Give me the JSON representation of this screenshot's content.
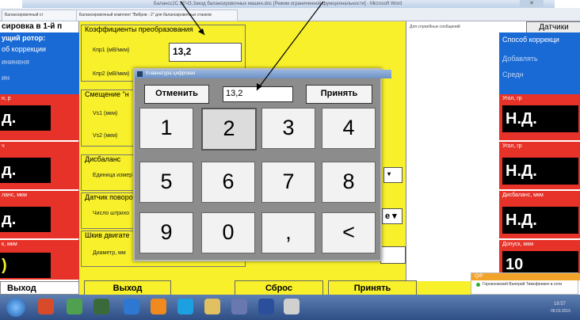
{
  "window": {
    "title": "Балансс2С 3ЕЧЗ.Заезд балансировочных машин.doc [Режим ограниченной функциональности] - Microsoft Word",
    "close_label": "✕"
  },
  "tabs": [
    "Балансировочный ст",
    "Балансировочный комплект \"Вибров - 2\" для балансировочных станков"
  ],
  "left_panel": {
    "header": "сировка в 1-й п",
    "rotor_label": "ущий ротор:",
    "correction_label": "об коррекции",
    "blue_lines": [
      "ининеня",
      "ин"
    ],
    "panels": [
      {
        "label": "н, р",
        "value": "д."
      },
      {
        "label": "ч",
        "value": "д."
      },
      {
        "label": "ланс, мкм",
        "value": "д."
      },
      {
        "label": "к, мкм",
        "value": ")"
      }
    ],
    "exit_label": "Выход"
  },
  "right_panel": {
    "sensors_button": "Датчики",
    "correction_title": "Способ коррекци",
    "blue_lines": [
      "Добавлять",
      "Средн"
    ],
    "panels": [
      {
        "label": "Угол, гр",
        "value": "Н.Д."
      },
      {
        "label": "Угол, гр",
        "value": "Н.Д."
      },
      {
        "label": "Дисбаланс, мкм",
        "value": "Н.Д."
      },
      {
        "label": "Допуск, мкм",
        "value": "10"
      }
    ]
  },
  "main": {
    "coeff_title": "Коэффициенты преобразования",
    "kpp1_label": "Кпр1 (мВ/мкм)",
    "kpp1_value": "13,2",
    "kpp2_label": "Кпр2 (мВ/мкм)",
    "offset_title": "Смещение \"н",
    "vs1_label": "Vs1 (мкм)",
    "vs2_label": "Vs2 (мкм)",
    "imbalance_title": "Дисбаланс",
    "unit_label": "Единица измер",
    "sensor_title": "Датчик поворо",
    "strokes_label": "Число штрихо",
    "pulley_title": "Шкив двигате",
    "diameter_label": "Диаметр, мм",
    "select_suffix": "е"
  },
  "message_panel": {
    "title": "Для служебных сообщений"
  },
  "bottom": {
    "exit": "Выход",
    "reset": "Сброс",
    "accept": "Принять"
  },
  "dialog": {
    "title": "Клавиатура цифровая",
    "cancel": "Отменить",
    "display": "13,2",
    "accept": "Принять",
    "keys": [
      "1",
      "2",
      "3",
      "4",
      "5",
      "6",
      "7",
      "8",
      "9",
      "0",
      ",",
      "<"
    ]
  },
  "notification": {
    "brand": "QIP",
    "message": "Горлиновский Валерий Тимофеевич в сети"
  },
  "taskbar": {
    "clock": "18:57",
    "date": "08.03.2015"
  }
}
